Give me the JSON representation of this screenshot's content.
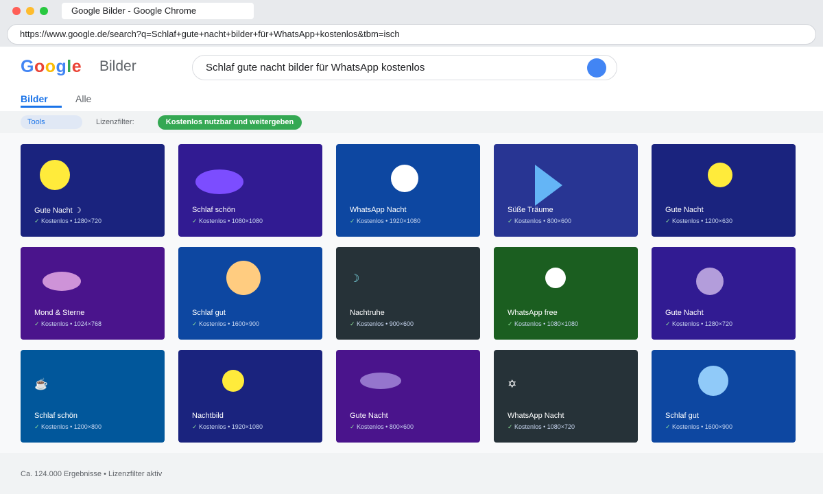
{
  "browser": {
    "tab_title": "Google Bilder - Google Chrome",
    "url": "https://www.google.de/search?q=Schlaf+gute+nacht+bilder+für+WhatsApp+kostenlos&tbm=isch"
  },
  "header": {
    "logo_letters": [
      "G",
      "o",
      "o",
      "g",
      "l",
      "e"
    ],
    "logo_colors": [
      "#4285f4",
      "#ea4335",
      "#fbbc05",
      "#4285f4",
      "#34a853",
      "#ea4335"
    ],
    "service_name": "Bilder",
    "search_query": "Schlaf gute nacht bilder für WhatsApp kostenlos",
    "search_button_color": "#4285f4"
  },
  "nav": {
    "tabs": [
      {
        "label": "Bilder",
        "active": true
      },
      {
        "label": "Alle",
        "active": false
      }
    ]
  },
  "toolbar": {
    "tools_label": "Tools",
    "filter_label": "Lizenzfilter:",
    "filter_chip": "Kostenlos nutzbar und weitergeben"
  },
  "results": [
    {
      "title": "Gute Nacht ☽",
      "meta": "Kostenlos • 1280×720",
      "bg": "#1a237e",
      "shape": "circle",
      "shape_color": "#ffeb3b",
      "glyph": ""
    },
    {
      "title": "Schlaf schön",
      "meta": "Kostenlos • 1080×1080",
      "bg": "#311b92",
      "shape": "ellipse",
      "shape_color": "#7c4dff",
      "glyph": ""
    },
    {
      "title": "WhatsApp Nacht",
      "meta": "Kostenlos • 1920×1080",
      "bg": "#0d47a1",
      "shape": "circle",
      "shape_color": "#ffffff",
      "glyph": ""
    },
    {
      "title": "Süße Träume",
      "meta": "Kostenlos • 800×600",
      "bg": "#283593",
      "shape": "triangle",
      "shape_color": "#64b5f6",
      "glyph": ""
    },
    {
      "title": "Gute Nacht",
      "meta": "Kostenlos • 1200×630",
      "bg": "#1a237e",
      "shape": "circle",
      "shape_color": "#ffeb3b",
      "glyph": ""
    },
    {
      "title": "Mond & Sterne",
      "meta": "Kostenlos • 1024×768",
      "bg": "#4a148c",
      "shape": "ellipse",
      "shape_color": "#ce93d8",
      "glyph": ""
    },
    {
      "title": "Schlaf gut",
      "meta": "Kostenlos • 1600×900",
      "bg": "#0d47a1",
      "shape": "circle",
      "shape_color": "#ffcc80",
      "glyph": ""
    },
    {
      "title": "Nachtruhe",
      "meta": "Kostenlos • 900×600",
      "bg": "#263238",
      "shape": "glyph",
      "shape_color": "#80deea",
      "glyph": "☽"
    },
    {
      "title": "WhatsApp free",
      "meta": "Kostenlos • 1080×1080",
      "bg": "#1b5e20",
      "shape": "circle",
      "shape_color": "#ffffff",
      "glyph": ""
    },
    {
      "title": "Gute Nacht",
      "meta": "Kostenlos • 1280×720",
      "bg": "#311b92",
      "shape": "circle",
      "shape_color": "#b39ddb",
      "glyph": ""
    },
    {
      "title": "Schlaf schön",
      "meta": "Kostenlos • 1200×800",
      "bg": "#01579b",
      "shape": "glyph",
      "shape_color": "#ffffff",
      "glyph": "☕"
    },
    {
      "title": "Nachtbild",
      "meta": "Kostenlos • 1920×1080",
      "bg": "#1a237e",
      "shape": "circle",
      "shape_color": "#ffeb3b",
      "glyph": ""
    },
    {
      "title": "Gute Nacht",
      "meta": "Kostenlos • 800×600",
      "bg": "#4a148c",
      "shape": "ellipse",
      "shape_color": "#9575cd",
      "glyph": ""
    },
    {
      "title": "WhatsApp Nacht",
      "meta": "Kostenlos • 1080×720",
      "bg": "#263238",
      "shape": "glyph",
      "shape_color": "#ffffff",
      "glyph": "✡"
    },
    {
      "title": "Schlaf gut",
      "meta": "Kostenlos • 1600×900",
      "bg": "#0d47a1",
      "shape": "circle",
      "shape_color": "#90caf9",
      "glyph": ""
    }
  ],
  "footer": {
    "text": "Ca. 124.000 Ergebnisse • Lizenzfilter aktiv"
  }
}
